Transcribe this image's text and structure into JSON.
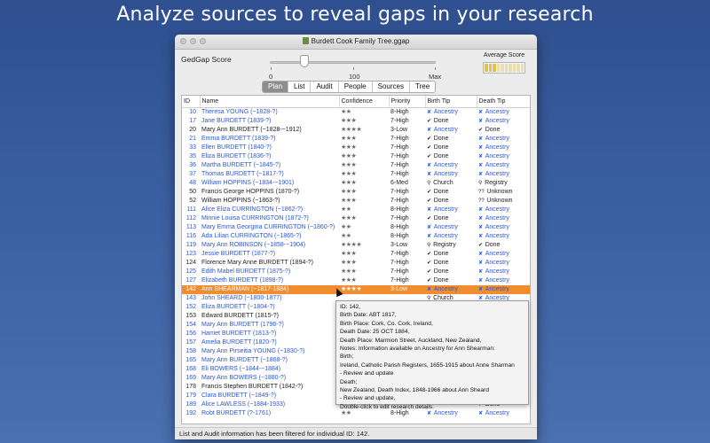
{
  "headline": "Analyze sources to reveal gaps in your research",
  "window": {
    "title": "Burdett Cook Family Tree.ggap"
  },
  "score": {
    "label": "GedGap Score",
    "min_label": "0",
    "mid_label": "100",
    "max_label": "Max",
    "average_label": "Average Score"
  },
  "tabs": [
    {
      "label": "Plan",
      "active": true
    },
    {
      "label": "List",
      "active": false
    },
    {
      "label": "Audit",
      "active": false
    },
    {
      "label": "People",
      "active": false
    },
    {
      "label": "Sources",
      "active": false
    },
    {
      "label": "Tree",
      "active": false
    }
  ],
  "table": {
    "columns": [
      "ID",
      "Name",
      "Confidence",
      "Priority",
      "Birth Tip",
      "Death Tip"
    ],
    "rows": [
      {
        "id": "10",
        "name": "Theresa YOUNG (~1828-?)",
        "conf": "★★",
        "priority": "8-High",
        "birth": "Ancestry",
        "death": "Ancestry",
        "blue": true
      },
      {
        "id": "17",
        "name": "Jane BURDETT (1839-?)",
        "conf": "★★★",
        "priority": "7-High",
        "birth": "Done",
        "death": "Ancestry",
        "blue": true
      },
      {
        "id": "20",
        "name": "Mary Ann BURDETT (~1828-~1912)",
        "conf": "★★★★",
        "priority": "3-Low",
        "birth": "Ancestry",
        "death": "Done",
        "blue": false
      },
      {
        "id": "21",
        "name": "Emma BURDETT (1839-?)",
        "conf": "★★★",
        "priority": "7-High",
        "birth": "Done",
        "death": "Ancestry",
        "blue": true
      },
      {
        "id": "33",
        "name": "Ellen BURDETT (1840-?)",
        "conf": "★★★",
        "priority": "7-High",
        "birth": "Done",
        "death": "Ancestry",
        "blue": true
      },
      {
        "id": "35",
        "name": "Eliza BURDETT (1836-?)",
        "conf": "★★★",
        "priority": "7-High",
        "birth": "Done",
        "death": "Ancestry",
        "blue": true
      },
      {
        "id": "36",
        "name": "Martha BURDETT (~1845-?)",
        "conf": "★★★",
        "priority": "7-High",
        "birth": "Ancestry",
        "death": "Ancestry",
        "blue": true
      },
      {
        "id": "37",
        "name": "Thomas BURDETT (~1817-?)",
        "conf": "★★★",
        "priority": "7-High",
        "birth": "Ancestry",
        "death": "Ancestry",
        "blue": true
      },
      {
        "id": "48",
        "name": "William HOPPINS (~1834-~1901)",
        "conf": "★★★",
        "priority": "6-Med",
        "birth": "Church",
        "death": "Registry",
        "blue": true
      },
      {
        "id": "50",
        "name": "Francis George HOPPINS (1870-?)",
        "conf": "★★★",
        "priority": "7-High",
        "birth": "Done",
        "death": "Unknown",
        "blue": false
      },
      {
        "id": "52",
        "name": "William HOPPINS (~1863-?)",
        "conf": "★★★",
        "priority": "7-High",
        "birth": "Done",
        "death": "Unknown",
        "blue": false
      },
      {
        "id": "111",
        "name": "Alice Eliza CURRINGTON (~1862-?)",
        "conf": "★★",
        "priority": "8-High",
        "birth": "Ancestry",
        "death": "Ancestry",
        "blue": true
      },
      {
        "id": "112",
        "name": "Minnie Louisa CURRINGTON (1872-?)",
        "conf": "★★★",
        "priority": "7-High",
        "birth": "Done",
        "death": "Ancestry",
        "blue": true
      },
      {
        "id": "113",
        "name": "Mary Emma Georgina CURRINGTON (~1860-?)",
        "conf": "★★",
        "priority": "8-High",
        "birth": "Ancestry",
        "death": "Ancestry",
        "blue": true
      },
      {
        "id": "116",
        "name": "Ada Lilian CURRINGTON (~1865-?)",
        "conf": "★★",
        "priority": "8-High",
        "birth": "Ancestry",
        "death": "Ancestry",
        "blue": true
      },
      {
        "id": "119",
        "name": "Mary Ann ROBINSON (~1858-~1904)",
        "conf": "★★★★",
        "priority": "3-Low",
        "birth": "Registry",
        "death": "Done",
        "blue": true
      },
      {
        "id": "123",
        "name": "Jessie BURDETT (1877-?)",
        "conf": "★★★",
        "priority": "7-High",
        "birth": "Done",
        "death": "Ancestry",
        "blue": true
      },
      {
        "id": "124",
        "name": "Florence Mary Anne BURDETT (1894-?)",
        "conf": "★★★",
        "priority": "7-High",
        "birth": "Done",
        "death": "Ancestry",
        "blue": false
      },
      {
        "id": "125",
        "name": "Edith Mabel BURDETT (1875-?)",
        "conf": "★★★",
        "priority": "7-High",
        "birth": "Done",
        "death": "Ancestry",
        "blue": true
      },
      {
        "id": "127",
        "name": "Elizabeth BURDETT (1898-?)",
        "conf": "★★★",
        "priority": "7-High",
        "birth": "Done",
        "death": "Ancestry",
        "blue": true
      },
      {
        "id": "142",
        "name": "Ann SHEARMAN (~1817-1884)",
        "conf": "★★★★",
        "priority": "3-Low",
        "birth": "Ancestry",
        "death": "Ancestry",
        "blue": true,
        "selected": true
      },
      {
        "id": "143",
        "name": "John SHEARD (~1800-1877)",
        "conf": "",
        "priority": "",
        "birth": "Church",
        "death": "Ancestry",
        "blue": true
      },
      {
        "id": "152",
        "name": "Eliza BURDETT (~1804-?)",
        "conf": "",
        "priority": "",
        "birth": "",
        "death": "",
        "blue": true
      },
      {
        "id": "153",
        "name": "Edward BURDETT (1815-?)",
        "conf": "",
        "priority": "",
        "birth": "",
        "death": "",
        "blue": false
      },
      {
        "id": "154",
        "name": "Mary Ann BURDETT (1796-?)",
        "conf": "",
        "priority": "",
        "birth": "",
        "death": "",
        "blue": true
      },
      {
        "id": "156",
        "name": "Harriet BURDETT (1813-?)",
        "conf": "",
        "priority": "",
        "birth": "",
        "death": "",
        "blue": true
      },
      {
        "id": "157",
        "name": "Amelia BURDETT (1820-?)",
        "conf": "",
        "priority": "",
        "birth": "",
        "death": "",
        "blue": true
      },
      {
        "id": "158",
        "name": "Mary Ann Pirseitia YOUNG (~1830-?)",
        "conf": "",
        "priority": "",
        "birth": "",
        "death": "",
        "blue": true
      },
      {
        "id": "165",
        "name": "Mary Ann BURDETT (~1868-?)",
        "conf": "",
        "priority": "",
        "birth": "",
        "death": "",
        "blue": true
      },
      {
        "id": "168",
        "name": "Eli BOWERS (~1844-~1884)",
        "conf": "",
        "priority": "",
        "birth": "",
        "death": "",
        "blue": true
      },
      {
        "id": "169",
        "name": "Mary Ann BOWERS (~1880-?)",
        "conf": "",
        "priority": "",
        "birth": "",
        "death": "",
        "blue": true
      },
      {
        "id": "178",
        "name": "Francis Stephen BURDETT (1842-?)",
        "conf": "",
        "priority": "",
        "birth": "",
        "death": "",
        "blue": false
      },
      {
        "id": "179",
        "name": "Clara BURDETT (~1849-?)",
        "conf": "",
        "priority": "",
        "birth": "",
        "death": "",
        "blue": true
      },
      {
        "id": "189",
        "name": "Alice LAWLESS (~1884-1933)",
        "conf": "★★★",
        "priority": "",
        "birth": "",
        "death": "Done",
        "blue": true
      },
      {
        "id": "192",
        "name": "Robt BURDETT (?-1761)",
        "conf": "★★",
        "priority": "8-High",
        "birth": "Ancestry",
        "death": "Ancestry",
        "blue": true
      }
    ]
  },
  "tooltip": {
    "lines": [
      "ID: 142,",
      "Birth Date: ABT 1817,",
      "Birth Place: Cork, Co. Cork, Ireland,",
      "Death Date: 25 OCT 1884,",
      "Death Place: Marmion Street, Auckland, New Zealand,",
      "Notes: Information available on Ancestry for Ann Shearman:",
      "Birth;",
      "Ireland, Catholic Parish Registers, 1655-1915 about Anne Sharman",
      "- Review and update",
      "Death;",
      "New Zealand, Death Index, 1848-1966 about Ann Sheard",
      "- Review and update,",
      "Double-click to edit research details."
    ]
  },
  "status": "List and Audit information has been filtered for individual ID: 142.",
  "colors": {
    "accent_blue": "#2a56d4",
    "selection": "#f08d2f",
    "background": "#3a5fa0"
  }
}
